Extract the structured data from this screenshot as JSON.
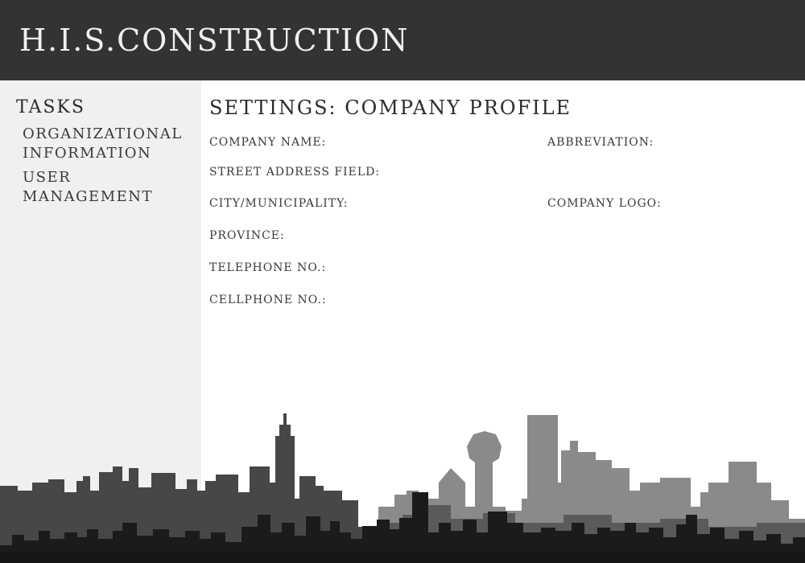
{
  "header": {
    "brand": "H.I.S.CONSTRUCTION"
  },
  "sidebar": {
    "title": "TASKS",
    "items": [
      {
        "label": "ORGANIZATIONAL INFORMATION"
      },
      {
        "label": "USER MANAGEMENT"
      }
    ]
  },
  "main": {
    "title": "SETTINGS: COMPANY PROFILE",
    "fields": {
      "company_name": "COMPANY NAME:",
      "abbreviation": "ABBREVIATION:",
      "street_address": "STREET ADDRESS FIELD:",
      "city": "CITY/MUNICIPALITY:",
      "company_logo": "COMPANY LOGO:",
      "province": "PROVINCE:",
      "telephone": "TELEPHONE NO.:",
      "cellphone": "CELLPHONE NO.:"
    }
  },
  "colors": {
    "header_bg": "#333333",
    "sidebar_bg": "#f0f0f0",
    "skyline_light": "#888888",
    "skyline_mid": "#4a4a4a",
    "skyline_dark": "#1c1a1a"
  }
}
